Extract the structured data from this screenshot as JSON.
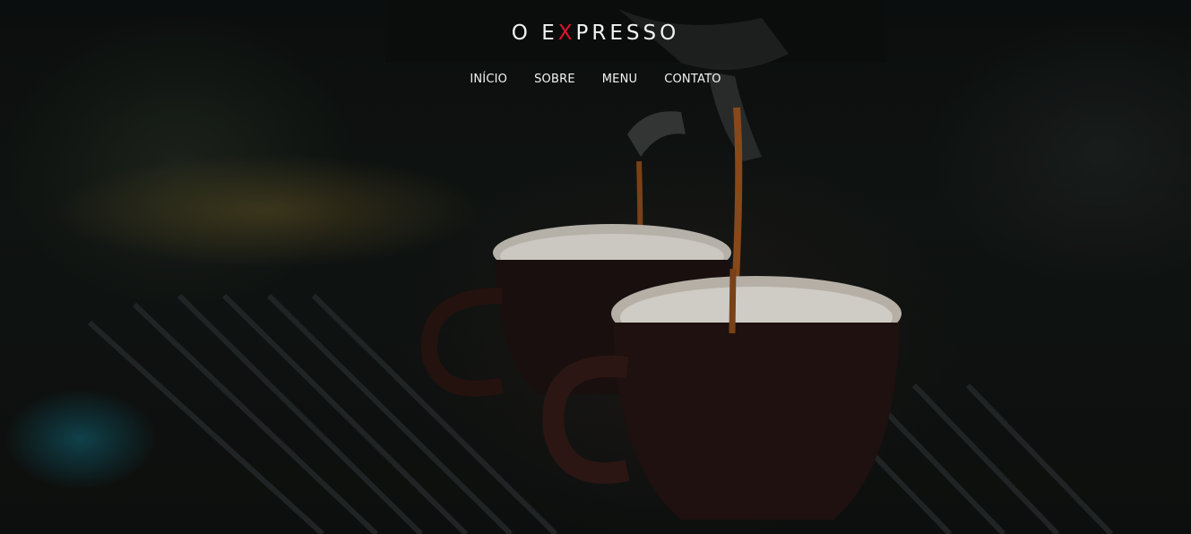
{
  "brand": {
    "prefix": "O E",
    "accent": "X",
    "suffix": "PRESSO",
    "accent_color": "#e0122b"
  },
  "nav": {
    "items": [
      {
        "label": "INÍCIO"
      },
      {
        "label": "SOBRE"
      },
      {
        "label": "MENU"
      },
      {
        "label": "CONTATO"
      }
    ]
  },
  "hero": {
    "background": "espresso-machine-pouring-coffee-photo"
  }
}
